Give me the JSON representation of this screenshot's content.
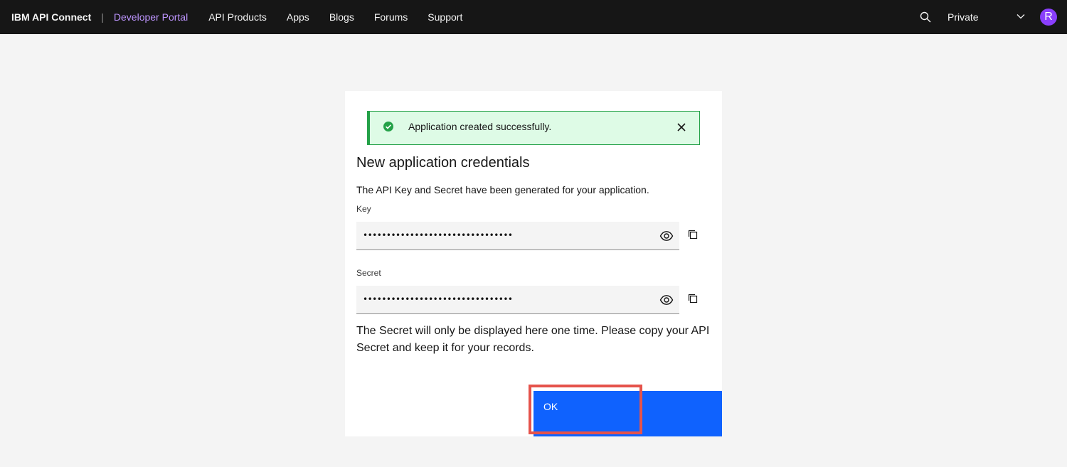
{
  "header": {
    "brand": "IBM API Connect",
    "separator": "|",
    "portal": "Developer Portal",
    "nav": [
      "API Products",
      "Apps",
      "Blogs",
      "Forums",
      "Support"
    ],
    "org": "Private",
    "avatar_initial": "R"
  },
  "toast": {
    "message": "Application created successfully.",
    "status_color": "#24a148"
  },
  "modal": {
    "title": "New application credentials",
    "description": "The API Key and Secret have been generated for your application.",
    "key_label": "Key",
    "key_value": "••••••••••••••••••••••••••••••••",
    "secret_label": "Secret",
    "secret_value": "••••••••••••••••••••••••••••••••",
    "note": "The Secret will only be displayed here one time. Please copy your API Secret and keep it for your records.",
    "ok_label": "OK"
  },
  "colors": {
    "primary": "#0f62fe",
    "portal_accent": "#be95ff",
    "avatar": "#8a3ffc",
    "highlight": "#e5534b"
  },
  "icons": [
    "search-icon",
    "chevron-down-icon",
    "checkmark-icon",
    "close-icon",
    "eye-icon",
    "copy-icon"
  ]
}
